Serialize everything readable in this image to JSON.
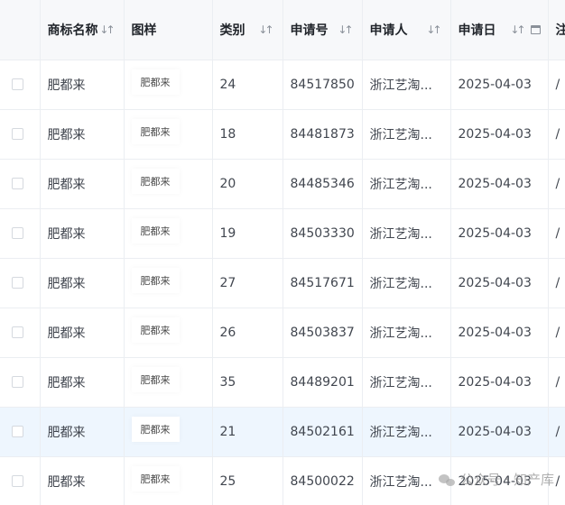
{
  "columns": {
    "name": "商标名称",
    "sample": "图样",
    "class": "类别",
    "regno": "申请号",
    "applicant": "申请人",
    "date": "申请日",
    "extra": "注"
  },
  "rows": [
    {
      "name": "肥都来",
      "sample": "肥都来",
      "class": "24",
      "regno": "84517850",
      "applicant": "浙江艺淘...",
      "date": "2025-04-03",
      "extra": "/"
    },
    {
      "name": "肥都来",
      "sample": "肥都来",
      "class": "18",
      "regno": "84481873",
      "applicant": "浙江艺淘...",
      "date": "2025-04-03",
      "extra": "/"
    },
    {
      "name": "肥都来",
      "sample": "肥都来",
      "class": "20",
      "regno": "84485346",
      "applicant": "浙江艺淘...",
      "date": "2025-04-03",
      "extra": "/"
    },
    {
      "name": "肥都来",
      "sample": "肥都来",
      "class": "19",
      "regno": "84503330",
      "applicant": "浙江艺淘...",
      "date": "2025-04-03",
      "extra": "/"
    },
    {
      "name": "肥都来",
      "sample": "肥都来",
      "class": "27",
      "regno": "84517671",
      "applicant": "浙江艺淘...",
      "date": "2025-04-03",
      "extra": "/"
    },
    {
      "name": "肥都来",
      "sample": "肥都来",
      "class": "26",
      "regno": "84503837",
      "applicant": "浙江艺淘...",
      "date": "2025-04-03",
      "extra": "/"
    },
    {
      "name": "肥都来",
      "sample": "肥都来",
      "class": "35",
      "regno": "84489201",
      "applicant": "浙江艺淘...",
      "date": "2025-04-03",
      "extra": "/"
    },
    {
      "name": "肥都来",
      "sample": "肥都来",
      "class": "21",
      "regno": "84502161",
      "applicant": "浙江艺淘...",
      "date": "2025-04-03",
      "extra": "/"
    },
    {
      "name": "肥都来",
      "sample": "肥都来",
      "class": "25",
      "regno": "84500022",
      "applicant": "浙江艺淘...",
      "date": "2025-04-03",
      "extra": "/"
    }
  ],
  "watermark": "公众号 · 知产库",
  "icons": {
    "sort": "sort-icon",
    "calendar": "calendar-icon",
    "checkbox": "checkbox-icon"
  },
  "colors": {
    "header_bg": "#f7f8fa",
    "row_selected_bg": "#eef6fe",
    "border": "#ebeef2"
  }
}
